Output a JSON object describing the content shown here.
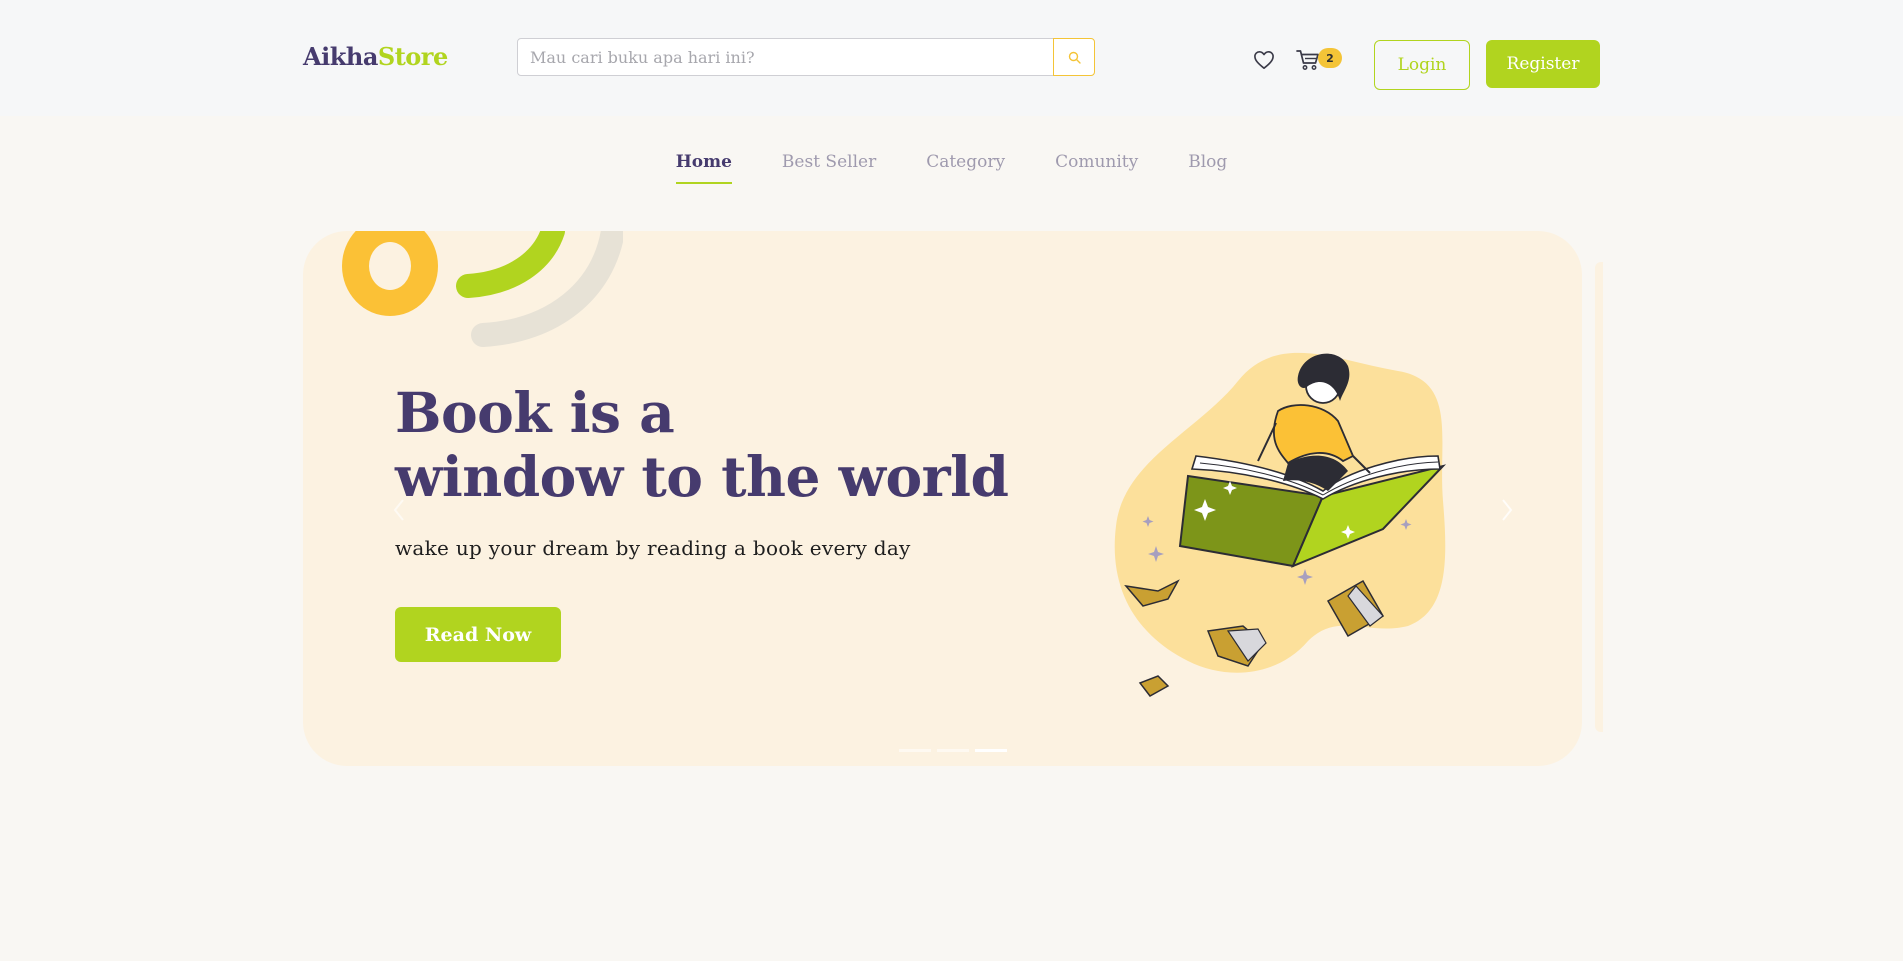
{
  "header": {
    "logo_part1": "Aikha",
    "logo_part2": "Store",
    "search_placeholder": "Mau cari buku apa hari ini?",
    "cart_count": "2",
    "login_label": "Login",
    "register_label": "Register"
  },
  "nav": {
    "items": [
      {
        "label": "Home",
        "active": true
      },
      {
        "label": "Best Seller",
        "active": false
      },
      {
        "label": "Category",
        "active": false
      },
      {
        "label": "Comunity",
        "active": false
      },
      {
        "label": "Blog",
        "active": false
      }
    ]
  },
  "hero": {
    "title_line1": "Book is a",
    "title_line2": "window to the world",
    "subtitle": "wake up your dream by reading a book every day",
    "cta_label": "Read Now",
    "slide_count": 3,
    "active_slide": 3
  },
  "colors": {
    "brand_dark": "#463b6e",
    "brand_green": "#b1d41f",
    "accent_yellow": "#f4c437",
    "hero_bg": "#fcf2e1"
  },
  "icons": {
    "search": "search-icon",
    "wishlist": "heart-icon",
    "cart": "cart-icon",
    "prev": "chevron-left-icon",
    "next": "chevron-right-icon"
  }
}
